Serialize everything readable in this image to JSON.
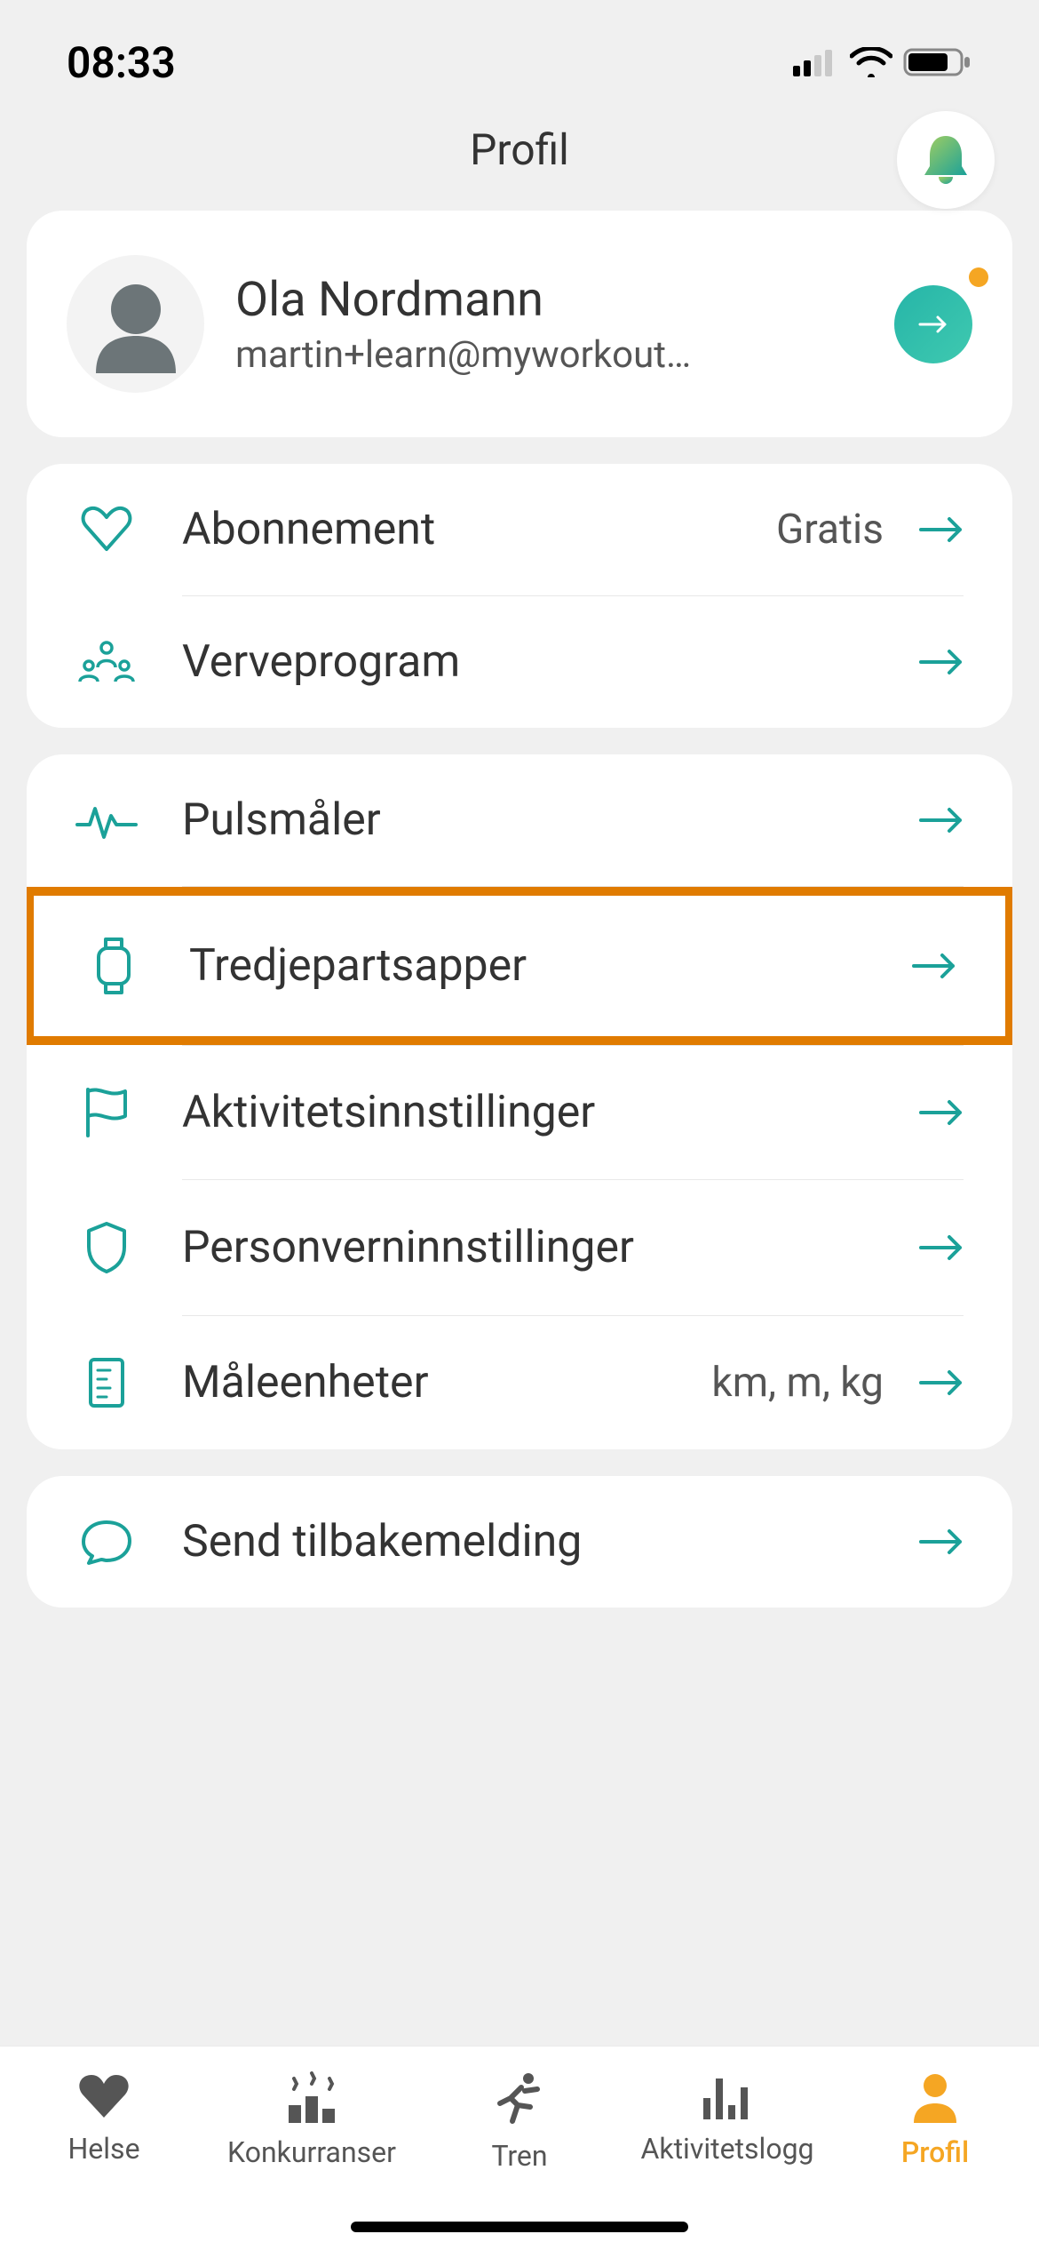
{
  "status": {
    "time": "08:33"
  },
  "header": {
    "title": "Profil"
  },
  "profile": {
    "name": "Ola Nordmann",
    "email": "martin+learn@myworkout…"
  },
  "group1": {
    "subscription": {
      "label": "Abonnement",
      "value": "Gratis"
    },
    "referral": {
      "label": "Verveprogram"
    }
  },
  "group2": {
    "hr_monitor": {
      "label": "Pulsmåler"
    },
    "third_party": {
      "label": "Tredjepartsapper"
    },
    "activity_settings": {
      "label": "Aktivitetsinnstillinger"
    },
    "privacy": {
      "label": "Personverninnstillinger"
    },
    "units": {
      "label": "Måleenheter",
      "value": "km, m, kg"
    }
  },
  "group3": {
    "feedback": {
      "label": "Send tilbakemelding"
    }
  },
  "tabs": {
    "health": "Helse",
    "competitions": "Konkurranser",
    "train": "Tren",
    "log": "Aktivitetslogg",
    "profile": "Profil"
  },
  "colors": {
    "accent": "#1ba199",
    "active": "#f5a623",
    "highlight": "#e07b00"
  }
}
